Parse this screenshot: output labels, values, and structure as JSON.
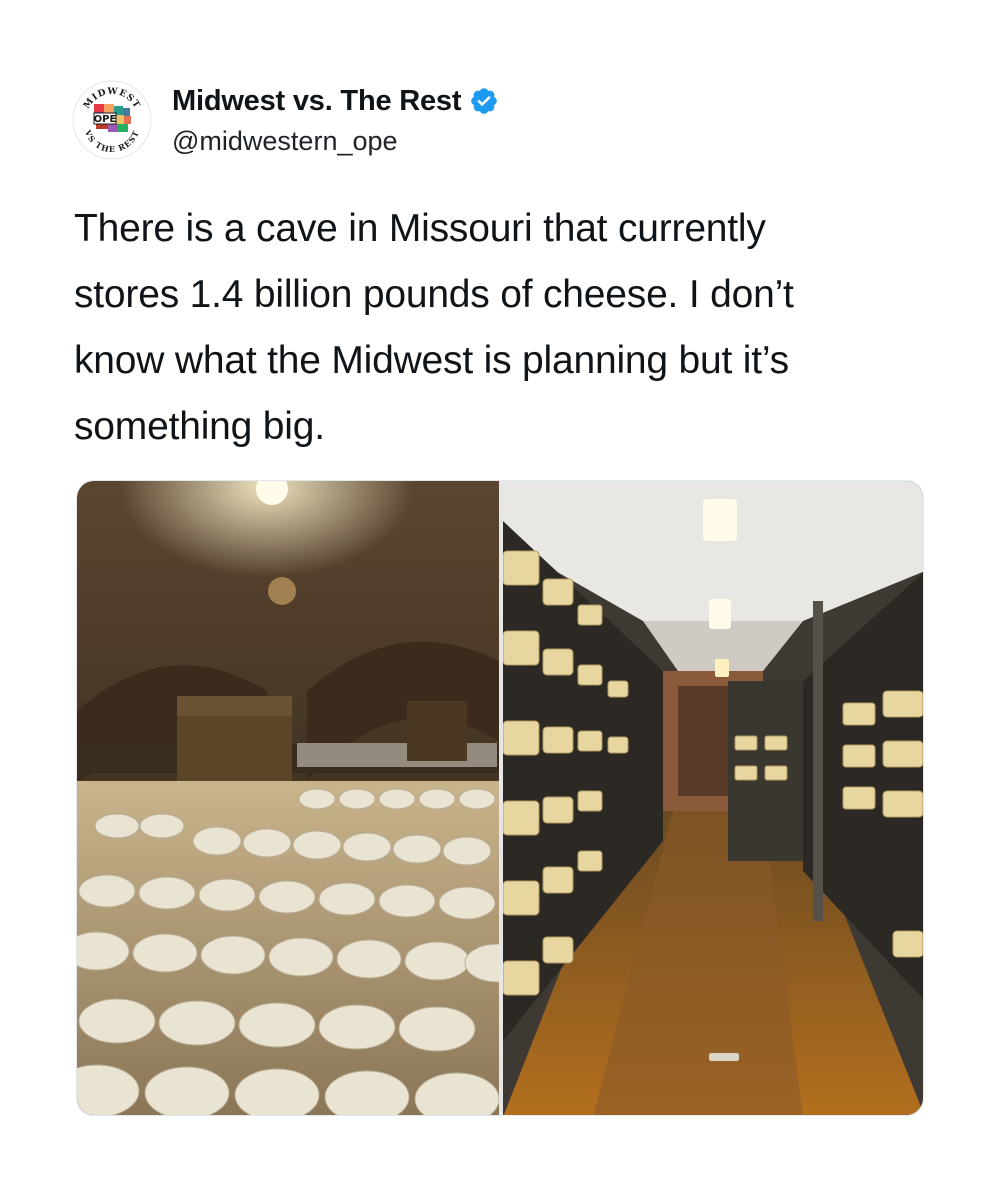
{
  "author": {
    "display_name": "Midwest vs. The Rest",
    "handle": "@midwestern_ope",
    "verified": true,
    "verified_icon": "verified-badge-icon",
    "verified_color": "#1d9bf0",
    "avatar": {
      "top_text": "MIDWEST",
      "center_text": "OPE",
      "bottom_text": "VS THE REST"
    }
  },
  "tweet": {
    "text_lines": [
      "There is a cave in Missouri that currently",
      "stores 1.4 billion pounds of cheese. I don’t",
      "know what the Midwest is planning but it’s",
      "something big."
    ]
  },
  "media": {
    "count": 2
  },
  "colors": {
    "text": "#0f1419",
    "background": "#ffffff",
    "accent": "#1d9bf0"
  }
}
